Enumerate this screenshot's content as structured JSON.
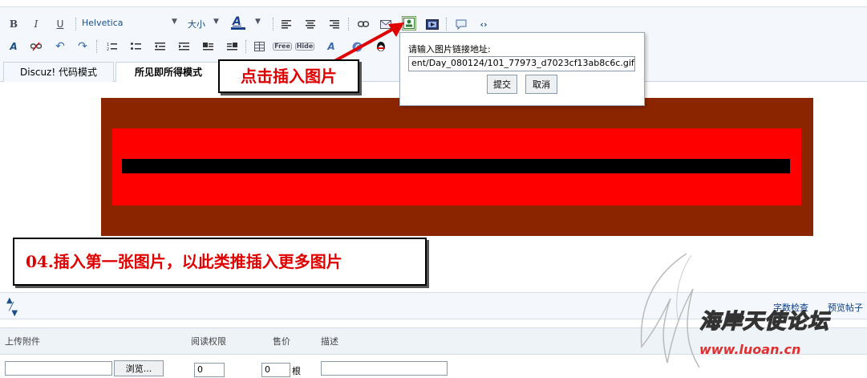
{
  "toolbar": {
    "bold": "B",
    "italic": "I",
    "underline": "U",
    "font_name": "Helvetica",
    "font_size": "大小",
    "font_color": "A",
    "free_label": "Free",
    "hide_label": "Hide"
  },
  "tabs": [
    {
      "label": "Discuz! 代码模式"
    },
    {
      "label": "所见即所得模式"
    }
  ],
  "popup": {
    "label": "请输入图片链接地址:",
    "url_value": "ent/Day_080124/101_77973_d7023cf13ab8c6c.gif",
    "submit_label": "提交",
    "cancel_label": "取消"
  },
  "callouts": {
    "top": "点击插入图片",
    "bottom": "04.插入第一张图片，以此类推插入更多图片"
  },
  "statusbar": {
    "word_count": "字数检查",
    "preview": "预览帖子"
  },
  "attachments": {
    "headers": {
      "upload": "上传附件",
      "permission": "阅读权限",
      "price": "售价",
      "description": "描述"
    },
    "browse_label": "浏览...",
    "permission_value": "0",
    "price_value": "0",
    "price_unit": "根"
  },
  "watermark": {
    "text": "海岸天使论坛",
    "url": "www.luoan.cn"
  },
  "colors": {
    "toolbar_bg": "#f4f8fc",
    "image_outer": "#8b2500",
    "image_middle": "#ff0000",
    "image_inner": "#000000",
    "callout_text": "#e00000",
    "arrow": "#e00000",
    "link": "#0b3f8e"
  }
}
